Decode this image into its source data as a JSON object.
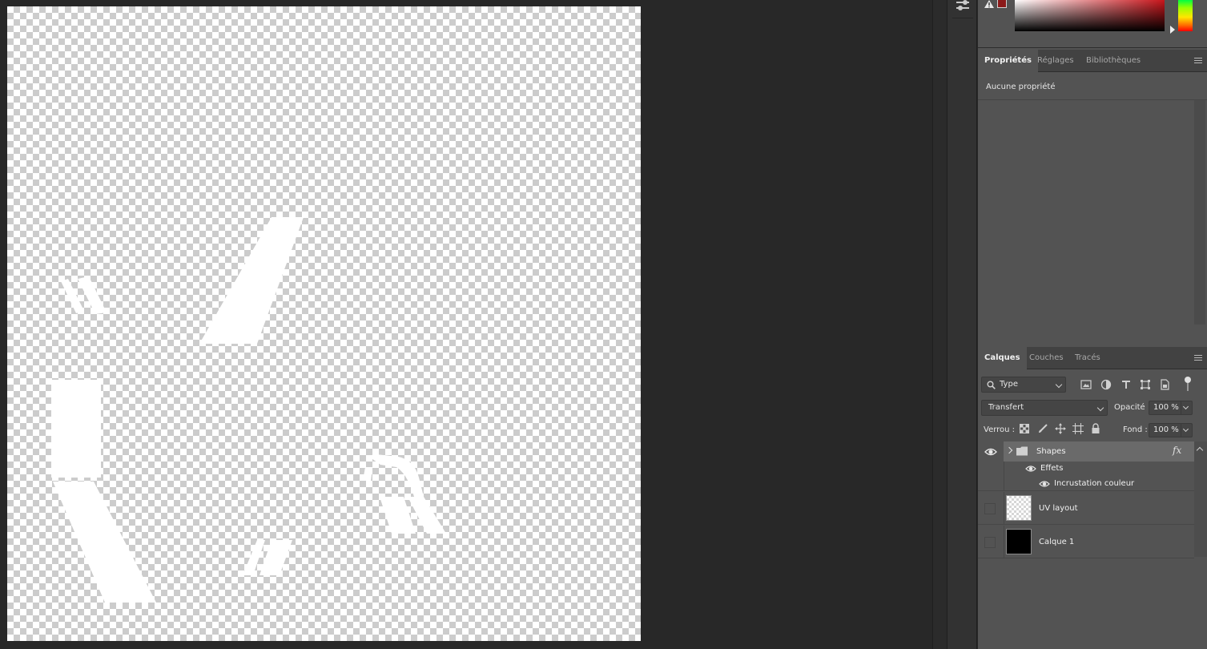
{
  "colors": {
    "canvas_checker_light": "#ffffff",
    "canvas_checker_dark": "#cccccc",
    "uv_shapes": "#ffffff",
    "foreground_swatch": "#8b1a1a",
    "panel_bg": "#535353",
    "workspace_bg": "#282828"
  },
  "icons": {
    "dock_tool": "adjustment-sliders-icon",
    "gamut_warning": "warning-triangle-icon",
    "panel_menu": "hamburger-menu-icon",
    "filter_search": "search-icon",
    "filter_pixel": "image-filter-icon",
    "filter_adjustment": "adjustment-filter-icon",
    "filter_type": "type-filter-icon",
    "filter_shape": "shape-filter-icon",
    "filter_smart": "smart-object-filter-icon",
    "lock_pixels": "lock-transparent-pixels-icon",
    "lock_image": "lock-image-pixels-icon",
    "lock_position": "lock-position-icon",
    "lock_artboard": "lock-artboard-icon",
    "lock_all": "lock-all-icon",
    "visibility": "eye-icon",
    "expand_group": "chevron-right-icon",
    "folder": "folder-icon",
    "fx": "fx-icon"
  },
  "properties_panel": {
    "tabs": [
      "Propriétés",
      "Réglages",
      "Bibliothèques"
    ],
    "active_tab": "Propriétés",
    "empty_text": "Aucune propriété"
  },
  "layers_panel": {
    "tabs": [
      "Calques",
      "Couches",
      "Tracés"
    ],
    "active_tab": "Calques",
    "filter_kind": "Type",
    "blend_mode": "Transfert",
    "opacity_label": "Opacité :",
    "opacity_value": "100 %",
    "lock_label": "Verrou :",
    "fill_label": "Fond :",
    "fill_value": "100 %",
    "fx_label": "fx",
    "layers": [
      {
        "name": "Shapes",
        "type": "group",
        "visible": true,
        "selected": true,
        "has_fx": true
      },
      {
        "name": "Effets",
        "type": "effects-header",
        "visible": true
      },
      {
        "name": "Incrustation couleur",
        "type": "effect",
        "visible": true
      },
      {
        "name": "UV layout",
        "type": "pixel",
        "visible": false,
        "thumbnail": "transparent"
      },
      {
        "name": "Calque 1",
        "type": "pixel",
        "visible": false,
        "thumbnail": "black"
      }
    ]
  }
}
